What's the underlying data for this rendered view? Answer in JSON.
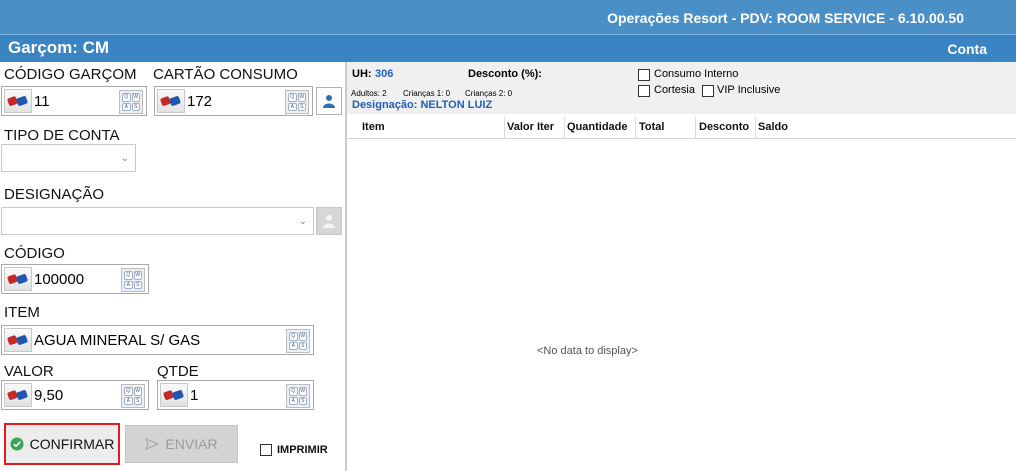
{
  "window": {
    "title": "Operações Resort - PDV: ROOM SERVICE - 6.10.00.50"
  },
  "header": {
    "waiter": "Garçom: CM",
    "account_tab": "Conta"
  },
  "form": {
    "codigo_garcom": {
      "label": "CÓDIGO GARÇOM",
      "value": "11"
    },
    "cartao_consumo": {
      "label": "CARTÃO CONSUMO",
      "value": "172"
    },
    "tipo_conta": {
      "label": "TIPO DE CONTA",
      "value": ""
    },
    "designacao": {
      "label": "DESIGNAÇÃO",
      "value": ""
    },
    "codigo": {
      "label": "CÓDIGO",
      "value": "100000"
    },
    "item": {
      "label": "ITEM",
      "value": "AGUA MINERAL S/ GAS"
    },
    "valor": {
      "label": "VALOR",
      "value": "9,50"
    },
    "qtde": {
      "label": "QTDE",
      "value": "1"
    },
    "keyboard_keys": [
      "Q",
      "W",
      "A",
      "S"
    ]
  },
  "buttons": {
    "confirmar": "CONFIRMAR",
    "enviar": "ENVIAR",
    "imprimir": "IMPRIMIR"
  },
  "info": {
    "uh_label": "UH:",
    "uh_value": "306",
    "desconto_label": "Desconto (%):",
    "adultos": "Adultos: 2",
    "criancas1": "Crianças 1: 0",
    "criancas2": "Crianças 2: 0",
    "designacao": "Designação: NELTON LUIZ",
    "consumo_interno": "Consumo Interno",
    "cortesia": "Cortesia",
    "vip": "VIP Inclusive"
  },
  "grid": {
    "columns": [
      "Item",
      "Valor Iter",
      "Quantidade",
      "Total",
      "Desconto",
      "Saldo"
    ],
    "empty_text": "<No data to display>"
  },
  "colors": {
    "title_bar": "#4a8fc6",
    "header_bar": "#3b84c4",
    "highlight": "#e11b1b",
    "link_blue": "#1f5fb8"
  }
}
